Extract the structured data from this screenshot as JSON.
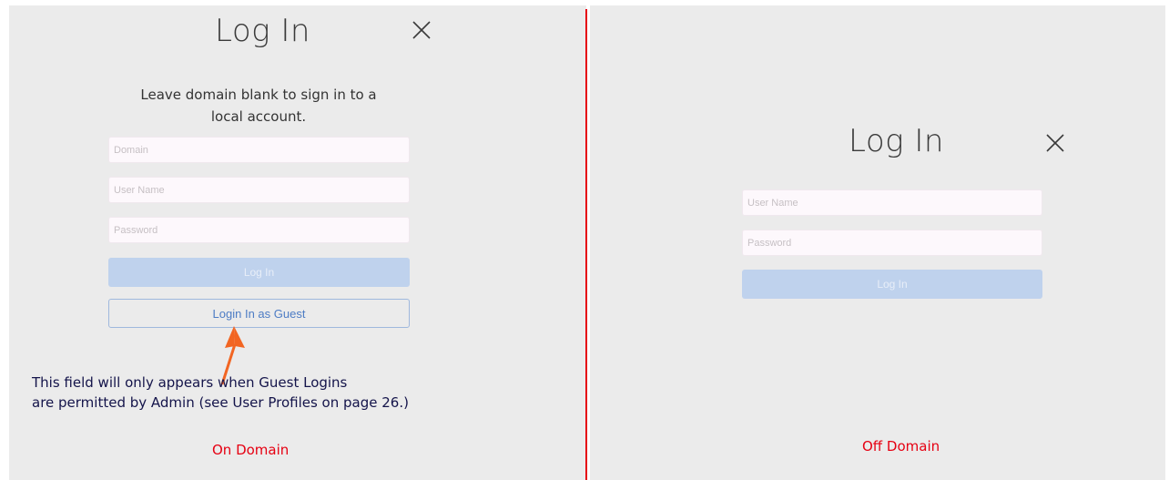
{
  "on_domain": {
    "title": "Log In",
    "close_icon": "close-icon",
    "hint_line1": "Leave domain blank to sign in to a",
    "hint_line2": "local account.",
    "domain_placeholder": "Domain",
    "username_placeholder": "User Name",
    "password_placeholder": "Password",
    "login_button": "Log In",
    "guest_button": "Login In as Guest",
    "note_line1": "This field will only appears when Guest Logins",
    "note_line2": "are permitted by Admin (see User Profiles  on page 26.)",
    "caption": "On Domain"
  },
  "off_domain": {
    "title": "Log In",
    "close_icon": "close-icon",
    "username_placeholder": "User Name",
    "password_placeholder": "Password",
    "login_button": "Log In",
    "caption": "Off Domain"
  },
  "colors": {
    "background": "#ebebeb",
    "divider": "#e60012",
    "caption": "#e60012",
    "arrow": "#f26522",
    "login_button_bg": "#bfd2ed",
    "guest_button_border": "#9fb8dd",
    "guest_button_text": "#4d7cc4"
  }
}
